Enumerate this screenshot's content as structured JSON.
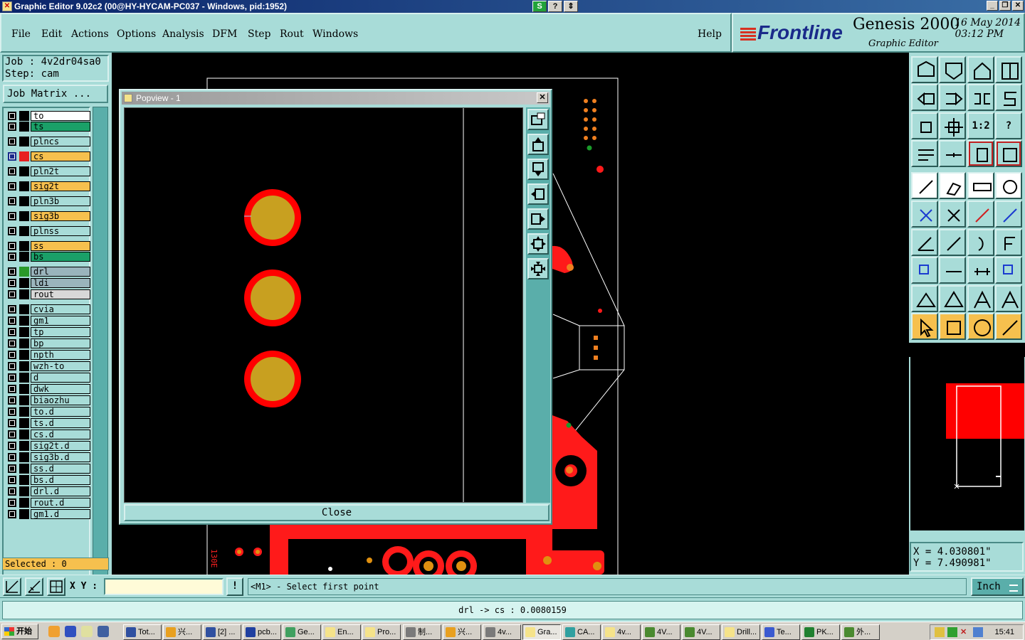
{
  "window": {
    "title": "Graphic Editor 9.02c2 (00@HY-HYCAM-PC037 - Windows, pid:1952)",
    "app_icon_glyph": "✕",
    "mid_buttons": [
      "S",
      "?",
      "⇕"
    ],
    "controls": [
      "_",
      "❐",
      "✕"
    ]
  },
  "menu": {
    "items": [
      "File",
      "Edit",
      "Actions",
      "Options",
      "Analysis",
      "DFM",
      "Step",
      "Rout",
      "Windows"
    ],
    "help": "Help"
  },
  "brand": {
    "logo": "Frontline",
    "product": "Genesis 2000",
    "subtitle": "Graphic Editor",
    "date": "16 May 2014",
    "time": "03:12 PM"
  },
  "job": {
    "job_line": "Job : 4v2dr04sa0",
    "step_line": "Step: cam",
    "matrix_button": "Job Matrix ..."
  },
  "layers": [
    {
      "name": "to",
      "color": "#ffffff",
      "swatch": ""
    },
    {
      "name": "ts",
      "color": "#1aa068",
      "swatch": ""
    },
    {
      "name": "plncs",
      "color": "#a8dcd8",
      "swatch": ""
    },
    {
      "name": "cs",
      "color": "#f6c04e",
      "swatch": "#e82020",
      "active": true
    },
    {
      "name": "pln2t",
      "color": "#a8dcd8",
      "swatch": ""
    },
    {
      "name": "sig2t",
      "color": "#f6c04e",
      "swatch": ""
    },
    {
      "name": "pln3b",
      "color": "#a8dcd8",
      "swatch": ""
    },
    {
      "name": "sig3b",
      "color": "#f6c04e",
      "swatch": ""
    },
    {
      "name": "plnss",
      "color": "#a8dcd8",
      "swatch": ""
    },
    {
      "name": "ss",
      "color": "#f6c04e",
      "swatch": ""
    },
    {
      "name": "bs",
      "color": "#1aa068",
      "swatch": ""
    },
    {
      "name": "drl",
      "color": "#9ab4bc",
      "swatch": "#2a9a2a"
    },
    {
      "name": "ldi",
      "color": "#9ab4bc",
      "swatch": ""
    },
    {
      "name": "rout",
      "color": "#d8d8d8",
      "swatch": ""
    },
    {
      "name": "cvia",
      "color": "#a8dcd8",
      "swatch": ""
    },
    {
      "name": "gm1",
      "color": "#a8dcd8",
      "swatch": "",
      "mark": "⬋"
    },
    {
      "name": "tp",
      "color": "#a8dcd8",
      "swatch": ""
    },
    {
      "name": "bp",
      "color": "#a8dcd8",
      "swatch": ""
    },
    {
      "name": "npth",
      "color": "#a8dcd8",
      "swatch": ""
    },
    {
      "name": "wzh-to",
      "color": "#a8dcd8",
      "swatch": ""
    },
    {
      "name": "d",
      "color": "#a8dcd8",
      "swatch": ""
    },
    {
      "name": "dwk",
      "color": "#a8dcd8",
      "swatch": ""
    },
    {
      "name": "biaozhu",
      "color": "#a8dcd8",
      "swatch": ""
    },
    {
      "name": "to.d",
      "color": "#a8dcd8",
      "swatch": ""
    },
    {
      "name": "ts.d",
      "color": "#a8dcd8",
      "swatch": ""
    },
    {
      "name": "cs.d",
      "color": "#a8dcd8",
      "swatch": ""
    },
    {
      "name": "sig2t.d",
      "color": "#a8dcd8",
      "swatch": ""
    },
    {
      "name": "sig3b.d",
      "color": "#a8dcd8",
      "swatch": ""
    },
    {
      "name": "ss.d",
      "color": "#a8dcd8",
      "swatch": ""
    },
    {
      "name": "bs.d",
      "color": "#a8dcd8",
      "swatch": ""
    },
    {
      "name": "drl.d",
      "color": "#a8dcd8",
      "swatch": ""
    },
    {
      "name": "rout.d",
      "color": "#a8dcd8",
      "swatch": ""
    },
    {
      "name": "gm1.d",
      "color": "#a8dcd8",
      "swatch": "",
      "mark": "⬋"
    }
  ],
  "selected": "Selected : 0",
  "popview": {
    "title": "Popview - 1",
    "close_button": "Close",
    "tools": [
      "zoom-window-icon",
      "pan-up-icon",
      "pan-down-icon",
      "pan-left-icon",
      "pan-right-icon",
      "zoom-in-icon",
      "zoom-out-icon"
    ]
  },
  "canvas": {
    "vertical_label": "130E"
  },
  "coords": {
    "x": "X = 4.030801\"",
    "y": "Y = 7.490981\""
  },
  "command": {
    "xy_label": "X Y :",
    "xy_value": "",
    "info_glyph": "!",
    "prompt": "<M1> - Select first point",
    "units": "Inch"
  },
  "status": {
    "message": "drl -> cs : 0.0080159"
  },
  "taskbar": {
    "start": "开始",
    "tasks": [
      "Tot...",
      "兴...",
      "[2] ...",
      "pcb...",
      "Ge...",
      "En...",
      "Pro...",
      "制...",
      "兴...",
      "4v...",
      "Gra...",
      "CA...",
      "4v...",
      "4V...",
      "4V...",
      "Drill...",
      "Te...",
      "PK...",
      "外..."
    ],
    "active_task": "Gra...",
    "clock": "15:41"
  },
  "colors": {
    "panel": "#a8dcd8",
    "accent_orange": "#f6c04e",
    "copper_red": "#ff0000",
    "pad_gold": "#c8a020"
  }
}
